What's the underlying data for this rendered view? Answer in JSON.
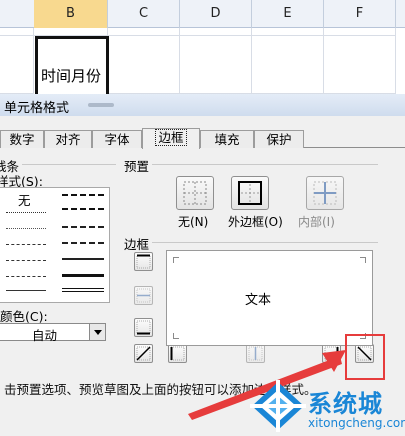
{
  "sheet": {
    "columns": [
      "B",
      "C",
      "D",
      "E",
      "F"
    ],
    "active_column": "B",
    "selected_cell_text": "时间月份"
  },
  "dialog": {
    "title": "单元格格式",
    "tabs": [
      {
        "label": "数字"
      },
      {
        "label": "对齐"
      },
      {
        "label": "字体"
      },
      {
        "label": "边框"
      },
      {
        "label": "填充"
      },
      {
        "label": "保护"
      }
    ],
    "active_tab": "边框",
    "line_section": {
      "title": "线条",
      "style_label": "样式(S):",
      "none_label": "无",
      "color_label": "颜色(C):",
      "color_value": "自动"
    },
    "preset_section": {
      "title": "预置",
      "none_label": "无(N)",
      "outline_label": "外边框(O)",
      "inside_label": "内部(I)"
    },
    "border_section": {
      "title": "边框",
      "preview_text": "文本"
    },
    "hint_text": "击预置选项、预览草图及上面的按钮可以添加边框样式。"
  },
  "annotation": {
    "highlight_color": "#e63c3c"
  },
  "watermark": {
    "title": "系统城",
    "url": "xitongcheng.com"
  }
}
